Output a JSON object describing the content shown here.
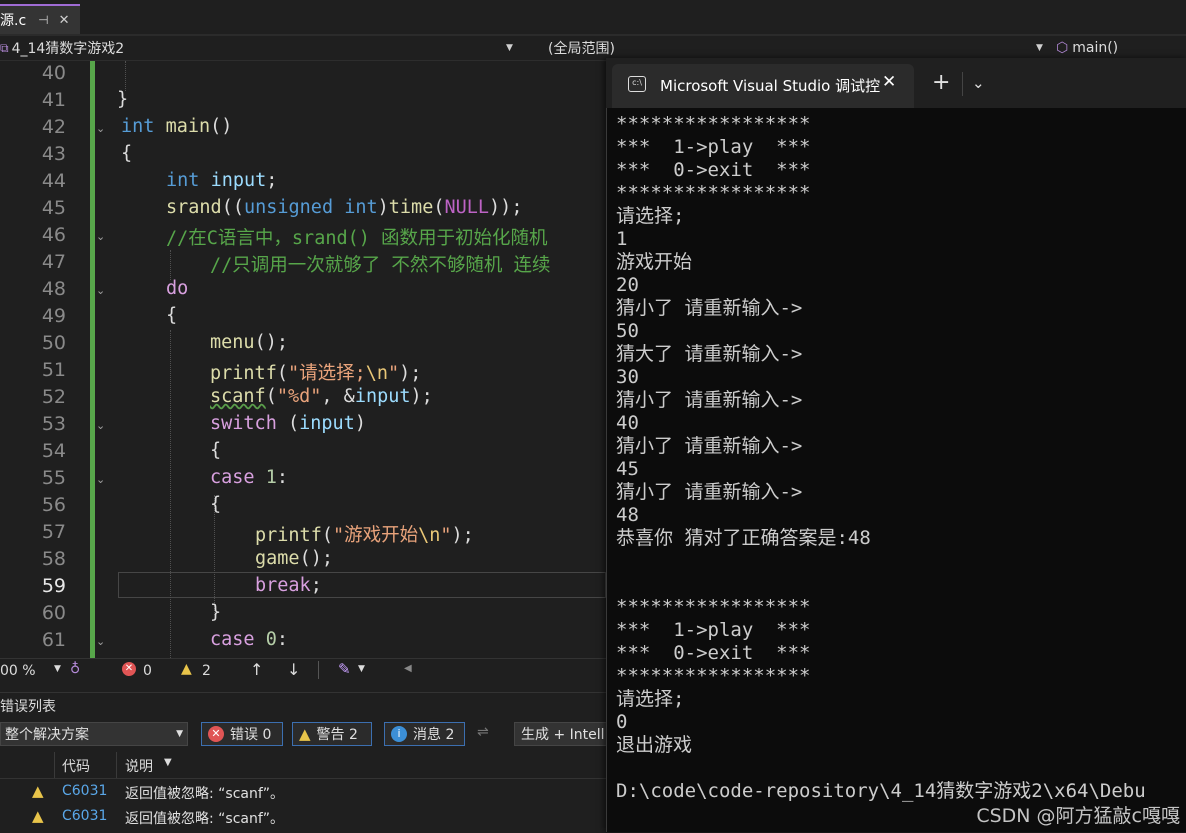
{
  "document_tab": {
    "name": "源.c",
    "pin_icon": "pin-icon",
    "close_icon": "close-icon"
  },
  "navbar": {
    "project": "4_14猜数字游戏2",
    "scope": "(全局范围)",
    "member": "main()"
  },
  "editor": {
    "lines": [
      {
        "n": "40"
      },
      {
        "n": "41"
      },
      {
        "n": "42"
      },
      {
        "n": "43"
      },
      {
        "n": "44"
      },
      {
        "n": "45"
      },
      {
        "n": "46"
      },
      {
        "n": "47"
      },
      {
        "n": "48"
      },
      {
        "n": "49"
      },
      {
        "n": "50"
      },
      {
        "n": "51"
      },
      {
        "n": "52"
      },
      {
        "n": "53"
      },
      {
        "n": "54"
      },
      {
        "n": "55"
      },
      {
        "n": "56"
      },
      {
        "n": "57"
      },
      {
        "n": "58"
      },
      {
        "n": "59"
      },
      {
        "n": "60"
      },
      {
        "n": "61"
      }
    ],
    "code": {
      "l41": "}",
      "l42_kw": "int",
      "l42_fn": "main",
      "l42_p": "()",
      "l43": "{",
      "l44_kw": "int",
      "l44_var": "input",
      "l44_p": ";",
      "l45_fn": "srand",
      "l45_a": "((",
      "l45_kw": "unsigned int",
      "l45_b": ")",
      "l45_fn2": "time",
      "l45_c": "(",
      "l45_mac": "NULL",
      "l45_d": "));",
      "l46_cmt": "//在C语言中，srand() 函数用于初始化随机",
      "l47_cmt": "//只调用一次就够了 不然不够随机 连续",
      "l48_ctl": "do",
      "l49": "{",
      "l50_fn": "menu",
      "l50_p": "();",
      "l51_fn": "printf",
      "l51_a": "(",
      "l51_str": "\"请选择;",
      "l51_esc": "\\n",
      "l51_str2": "\"",
      "l51_b": ");",
      "l52_fn": "scanf",
      "l52_a": "(",
      "l52_str": "\"%d\"",
      "l52_b": ", &",
      "l52_var": "input",
      "l52_c": ");",
      "l53_ctl": "switch",
      "l53_a": " (",
      "l53_var": "input",
      "l53_b": ")",
      "l54": "{",
      "l55_ctl": "case",
      "l55_num": "1",
      "l55_p": ":",
      "l56": "{",
      "l57_fn": "printf",
      "l57_a": "(",
      "l57_str": "\"游戏开始",
      "l57_esc": "\\n",
      "l57_str2": "\"",
      "l57_b": ");",
      "l58_fn": "game",
      "l58_p": "();",
      "l59_ctl": "break",
      "l59_p": ";",
      "l60": "}",
      "l61_ctl": "case",
      "l61_num": "0",
      "l61_p": ":"
    }
  },
  "edstatus": {
    "zoom": "00 %",
    "errors": "0",
    "warnings": "2"
  },
  "error_list": {
    "title": "错误列表",
    "scope": "整个解决方案",
    "errors_btn": "错误 0",
    "warnings_btn": "警告 2",
    "messages_btn": "消息 2",
    "build_filter": "生成 + Intell",
    "col_code": "代码",
    "col_desc": "说明",
    "rows": [
      {
        "code": "C6031",
        "desc": "返回值被忽略: “scanf”。"
      },
      {
        "code": "C6031",
        "desc": "返回值被忽略: “scanf”。"
      }
    ]
  },
  "console": {
    "tab_title": "Microsoft Visual Studio 调试控",
    "output": "*****************\n***  1->play  ***\n***  0->exit  ***\n*****************\n请选择;\n1\n游戏开始\n20\n猜小了 请重新输入->\n50\n猜大了 请重新输入->\n30\n猜小了 请重新输入->\n40\n猜小了 请重新输入->\n45\n猜小了 请重新输入->\n48\n恭喜你 猜对了正确答案是:48\n\n\n*****************\n***  1->play  ***\n***  0->exit  ***\n*****************\n请选择;\n0\n退出游戏\n\nD:\\code\\code-repository\\4_14猜数字游戏2\\x64\\Debu"
  },
  "watermark": "CSDN @阿方猛敲c嘎嘎"
}
